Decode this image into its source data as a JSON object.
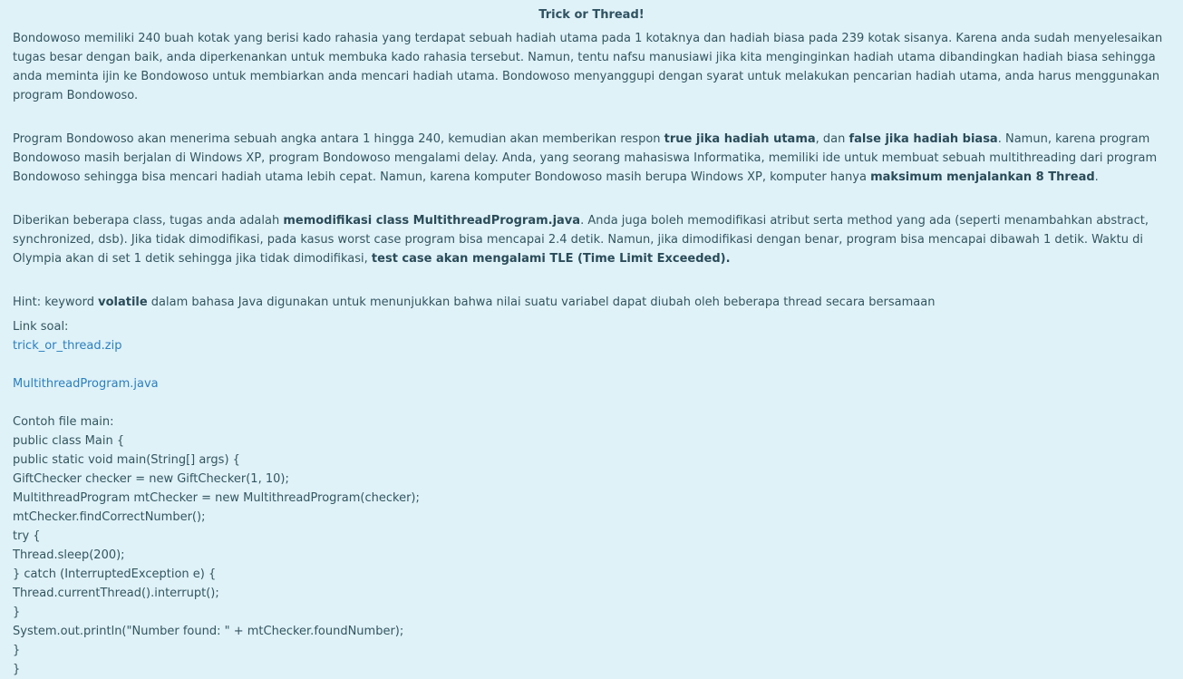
{
  "title": "Trick or Thread!",
  "p1": {
    "text": "Bondowoso memiliki 240 buah kotak yang berisi kado rahasia yang terdapat sebuah hadiah utama pada 1 kotaknya dan hadiah biasa pada 239 kotak sisanya. Karena anda sudah menyelesaikan tugas besar dengan baik, anda diperkenankan untuk membuka kado rahasia tersebut. Namun, tentu nafsu manusiawi jika kita menginginkan hadiah utama dibandingkan hadiah biasa sehingga anda meminta ijin ke Bondowoso untuk membiarkan anda mencari hadiah utama. Bondowoso menyanggupi dengan syarat untuk melakukan pencarian hadiah utama, anda harus menggunakan program Bondowoso."
  },
  "p2": {
    "t1": "Program Bondowoso akan menerima sebuah angka antara 1 hingga 240, kemudian akan memberikan respon ",
    "b1": "true jika hadiah utama",
    "t2": ", dan ",
    "b2": "false jika hadiah biasa",
    "t3": ". Namun, karena program Bondowoso masih berjalan di Windows XP, program Bondowoso mengalami delay. Anda, yang seorang mahasiswa Informatika, memiliki ide untuk membuat sebuah multithreading dari program Bondowoso sehingga bisa mencari hadiah utama lebih cepat. Namun, karena komputer Bondowoso masih berupa Windows XP, komputer hanya ",
    "b3": "maksimum menjalankan 8 Thread",
    "t4": "."
  },
  "p3": {
    "t1": "Diberikan beberapa class, tugas anda adalah ",
    "b1": "memodifikasi class MultithreadProgram.java",
    "t2": ". Anda juga boleh memodifikasi atribut serta method yang ada (seperti menambahkan abstract, synchronized, dsb). Jika tidak dimodifikasi, pada kasus worst case program bisa mencapai 2.4 detik. Namun, jika dimodifikasi dengan benar, program bisa mencapai dibawah 1 detik. Waktu di Olympia akan di set 1 detik sehingga jika tidak dimodifikasi, ",
    "b2": "test case akan mengalami TLE (Time Limit Exceeded)."
  },
  "hint": {
    "t1": "Hint: keyword ",
    "b1": "volatile",
    "t2": " dalam bahasa Java digunakan untuk menunjukkan bahwa nilai suatu variabel dapat diubah oleh beberapa thread secara bersamaan"
  },
  "links": {
    "label": "Link soal:",
    "zip": "trick_or_thread.zip",
    "java": "MultithreadProgram.java"
  },
  "example": {
    "label": "Contoh file main:",
    "lines": [
      "public class Main {",
      "public static void main(String[] args) {",
      "GiftChecker checker = new GiftChecker(1, 10);",
      "MultithreadProgram mtChecker = new MultithreadProgram(checker);",
      "mtChecker.findCorrectNumber();",
      "try {",
      "Thread.sleep(200);",
      "} catch (InterruptedException e) {",
      "Thread.currentThread().interrupt();",
      "}",
      "System.out.println(\"Number found: \" + mtChecker.foundNumber);",
      "}",
      "}"
    ]
  }
}
